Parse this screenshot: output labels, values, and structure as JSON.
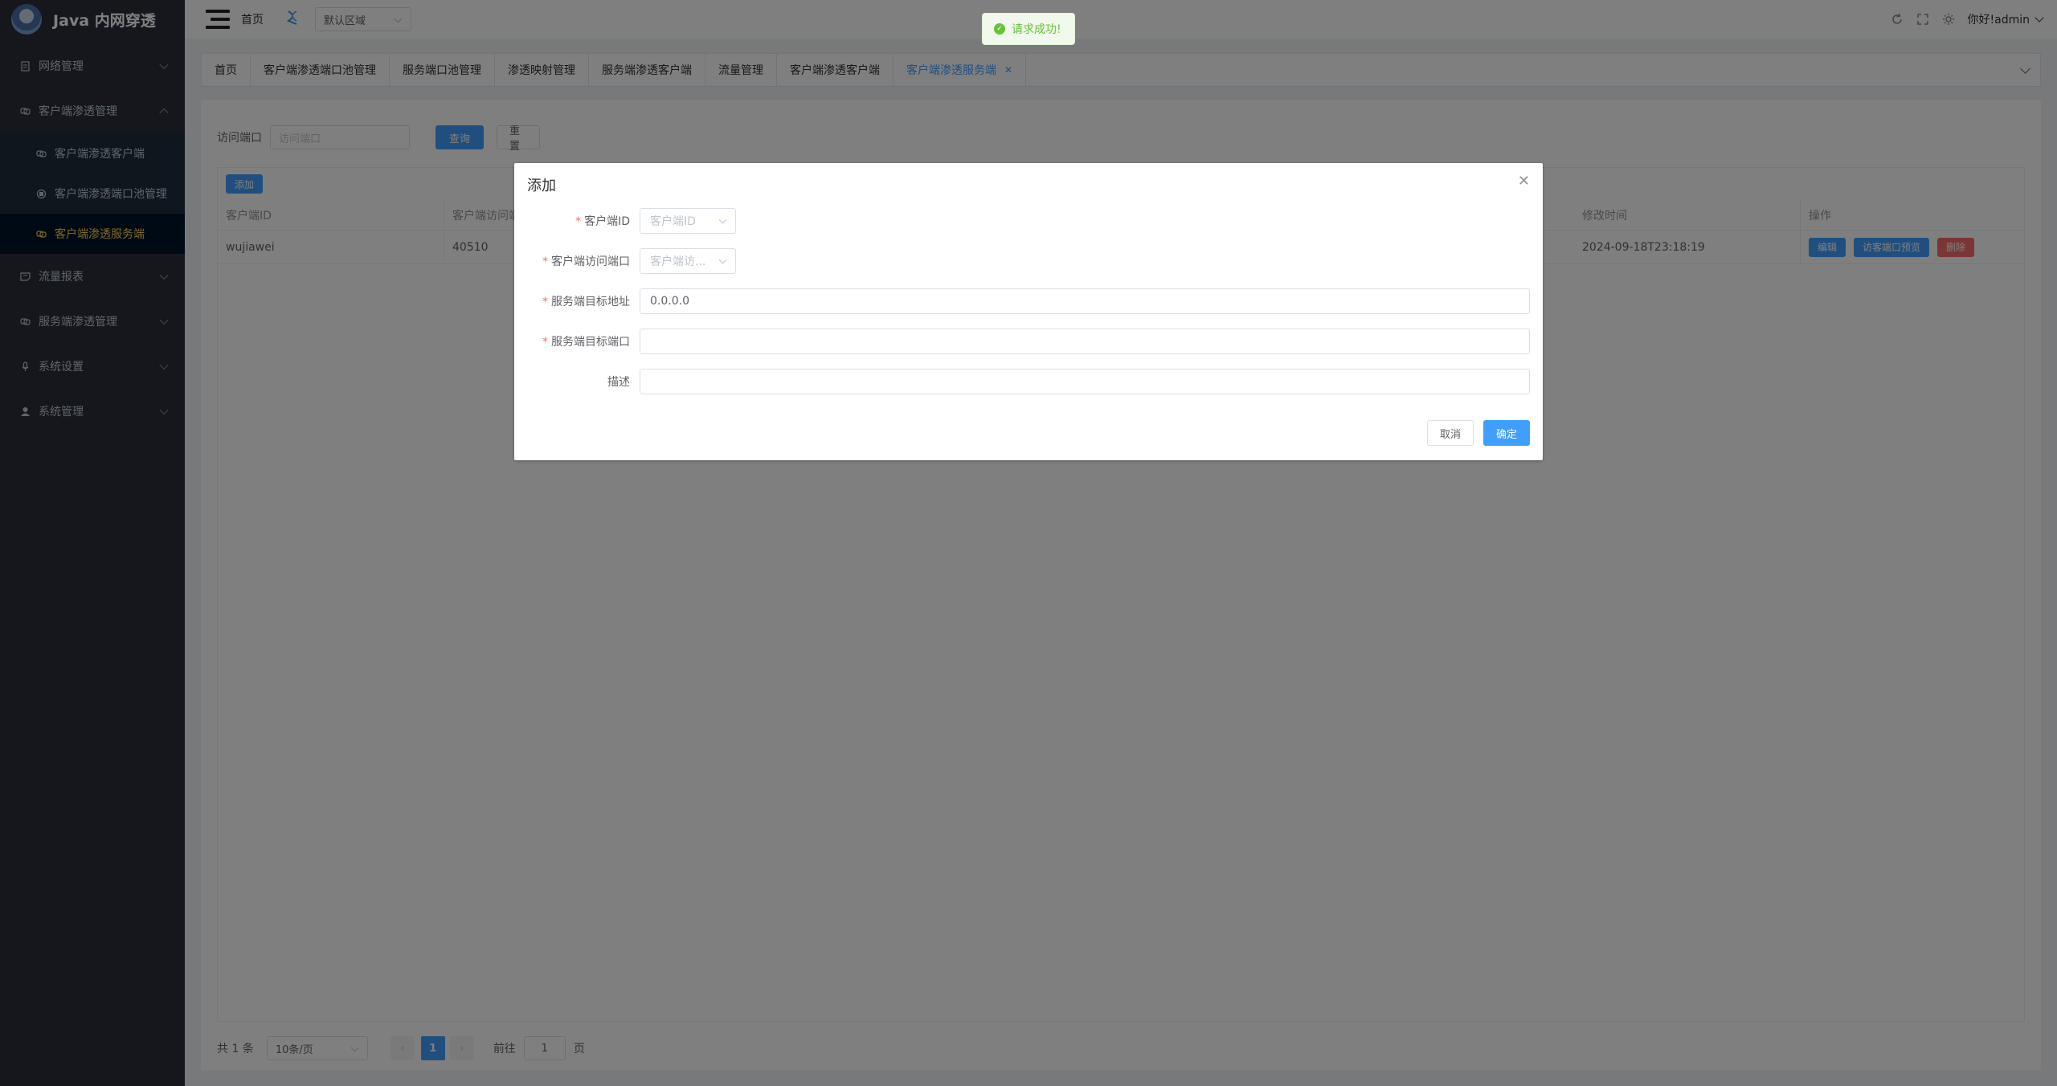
{
  "app": {
    "title": "Java 内网穿透"
  },
  "sidebar": {
    "items": [
      {
        "label": "网络管理",
        "icon": "document-icon"
      },
      {
        "label": "客户端渗透管理",
        "icon": "link-icon",
        "expanded": true,
        "children": [
          {
            "label": "客户端渗透客户端",
            "icon": "link-icon"
          },
          {
            "label": "客户端渗透端口池管理",
            "icon": "port-icon"
          },
          {
            "label": "客户端渗透服务端",
            "icon": "link-icon",
            "active": true
          }
        ]
      },
      {
        "label": "流量报表",
        "icon": "chart-icon"
      },
      {
        "label": "服务端渗透管理",
        "icon": "link-icon"
      },
      {
        "label": "系统设置",
        "icon": "mic-icon"
      },
      {
        "label": "系统管理",
        "icon": "user-icon"
      }
    ]
  },
  "header": {
    "breadcrumb": "首页",
    "region": "默认区域",
    "user": "你好!admin"
  },
  "tabs": [
    {
      "label": "首页"
    },
    {
      "label": "客户端渗透端口池管理"
    },
    {
      "label": "服务端口池管理"
    },
    {
      "label": "渗透映射管理"
    },
    {
      "label": "服务端渗透客户端"
    },
    {
      "label": "流量管理"
    },
    {
      "label": "客户端渗透客户端"
    },
    {
      "label": "客户端渗透服务端",
      "active": true,
      "closable": true
    }
  ],
  "search": {
    "label": "访问端口",
    "placeholder": "访问端口",
    "query": "查询",
    "reset": "重置"
  },
  "table": {
    "add_label": "添加",
    "columns": [
      "客户端ID",
      "客户端访问端口",
      "修改时间",
      "操作"
    ],
    "rows": [
      {
        "client_id": "wujiawei",
        "port": "40510",
        "modified": "2024-09-18T23:18:19"
      }
    ],
    "ops": {
      "edit": "编辑",
      "preview": "访客端口预览",
      "delete": "删除"
    }
  },
  "pagination": {
    "total": "共 1 条",
    "page_size": "10条/页",
    "prev": "‹",
    "current": "1",
    "next": "›",
    "goto_label": "前往",
    "goto_value": "1",
    "page_suffix": "页"
  },
  "dialog": {
    "title": "添加",
    "fields": {
      "client_id": {
        "label": "客户端ID",
        "placeholder": "客户端ID"
      },
      "client_port": {
        "label": "客户端访问端口",
        "placeholder": "客户端访..."
      },
      "target_addr": {
        "label": "服务端目标地址",
        "value": "0.0.0.0"
      },
      "target_port": {
        "label": "服务端目标端口",
        "value": ""
      },
      "desc": {
        "label": "描述",
        "value": ""
      }
    },
    "cancel": "取消",
    "confirm": "确定"
  },
  "toast": {
    "message": "请求成功!"
  },
  "colors": {
    "primary": "#409eff",
    "danger": "#f56c6c",
    "success": "#67c23a",
    "sidebar": "#2b2f3a",
    "active_menu": "#ffd04b"
  }
}
